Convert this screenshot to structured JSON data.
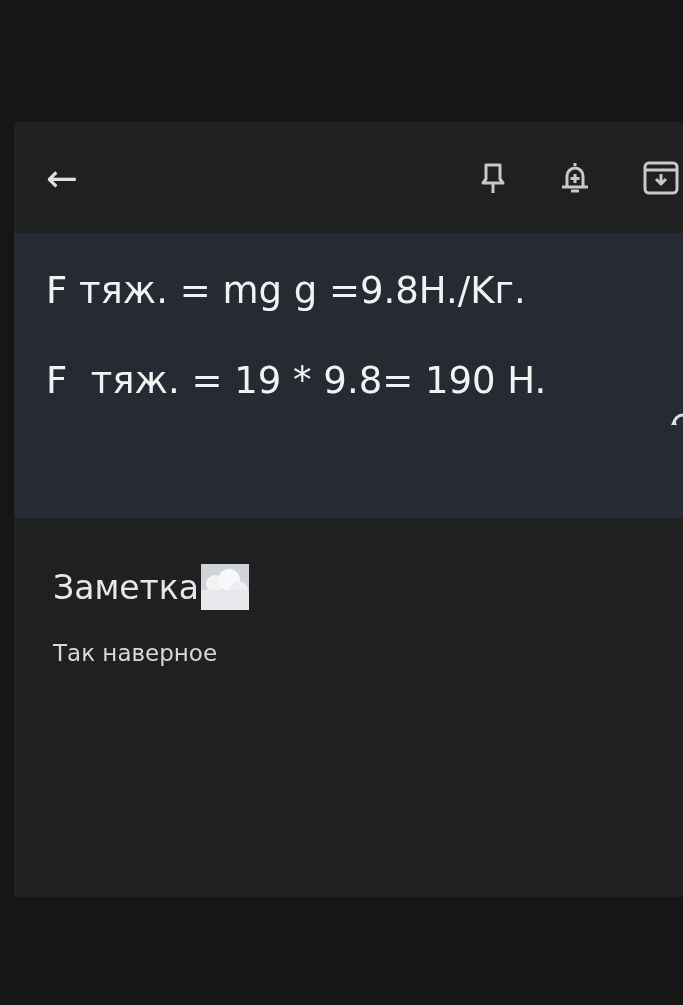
{
  "toolbar": {
    "back": "←"
  },
  "attached_image": {
    "lines": [
      "F тяж. = mg g =9.8H./Kг.",
      "F  тяж. = 19 * 9.8= 190 H."
    ]
  },
  "note": {
    "title": "Заметка",
    "body": "Так наверное"
  }
}
